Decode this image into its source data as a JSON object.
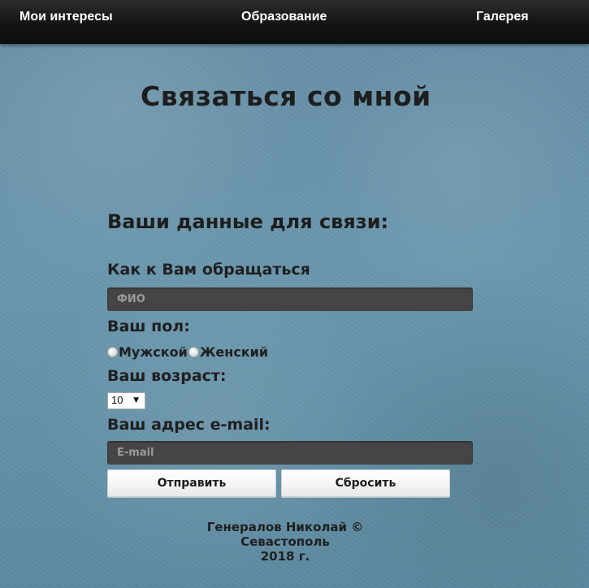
{
  "nav": {
    "items": [
      "Мои интересы",
      "Образование",
      "Галерея"
    ]
  },
  "page": {
    "title": "Связаться со мной"
  },
  "form": {
    "section_title": "Ваши данные для связи:",
    "name_label": "Как к Вам обращаться",
    "name_placeholder": "ФИО",
    "gender_label": "Ваш пол:",
    "gender_options": [
      "Мужской",
      "Женский"
    ],
    "age_label": "Ваш возраст:",
    "age_value": "10",
    "email_label": "Ваш адрес e-mail:",
    "email_placeholder": "E-mail",
    "submit_label": "Отправить",
    "reset_label": "Сбросить"
  },
  "footer": {
    "lines": [
      "Генералов Николай ©",
      "Севастополь",
      "2018 г."
    ]
  },
  "colors": {
    "header": "#141414",
    "background": "#6b98ae",
    "input_bg": "#454545"
  },
  "icons": {
    "select_arrow": "chevron-down-icon"
  }
}
